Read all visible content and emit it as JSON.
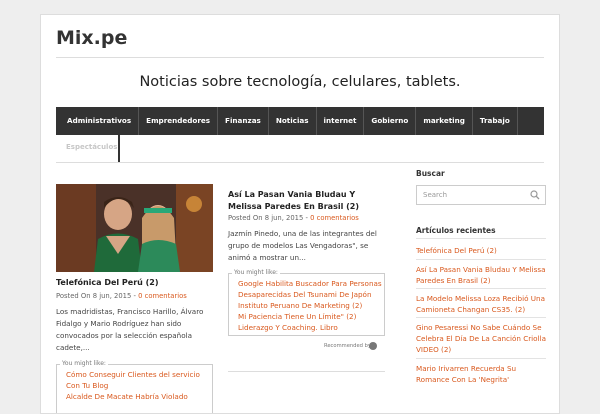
{
  "site": {
    "title": "Mix.pe",
    "tagline": "Noticias sobre tecnología, celulares, tablets."
  },
  "nav": {
    "items": [
      "Administrativos",
      "Emprendedores",
      "Finanzas",
      "Noticias",
      "internet",
      "Gobierno",
      "marketing",
      "Trabajo"
    ],
    "sub": "Espectáculos"
  },
  "posts": [
    {
      "title": "Telefónica Del Perú (2)",
      "posted_on": "Posted On",
      "date": "8 jun, 2015",
      "sep": "-",
      "comments": "0 comentarios",
      "excerpt": "Los madridistas, Francisco Harillo, Álvaro Fidalgo y Mario Rodríguez han sido convocados por la selección española cadete,...",
      "you_might_like": "You might like:",
      "related": [
        "Cómo Conseguir Clientes del servicio Con Tu Blog",
        "Alcalde De Macate Habría Violado"
      ]
    },
    {
      "title": "Así La Pasan Vania Bludau Y Melissa Paredes En Brasil (2)",
      "posted_on": "Posted On",
      "date": "8 jun, 2015",
      "sep": "-",
      "comments": "0 comentarios",
      "excerpt": "Jazmín Pinedo, una de las integrantes del grupo de modelos Las Vengadoras\", se animó a mostrar un...",
      "you_might_like": "You might like:",
      "related": [
        "Google Habilita Buscador Para Personas Desaparecidas Del Tsunami De Japón",
        "Instituto Peruano De Marketing (2)",
        "Mi Paciencia Tiene Un Límite\" (2)",
        "Liderazgo Y Coaching. Libro"
      ],
      "recommended_by": "Recommended by"
    }
  ],
  "sidebar": {
    "search_heading": "Buscar",
    "search_placeholder": "Search",
    "recent_heading": "Artículos recientes",
    "recent": [
      "Telefónica Del Perú (2)",
      "Así La Pasan Vania Bludau Y Melissa Paredes En Brasil (2)",
      "La Modelo Melissa Loza Recibió Una Camioneta Changan CS35. (2)",
      "Gino Pesaressi No Sabe Cuándo Se Celebra El Día De La Canción Criolla VIDEO (2)",
      "Mario Irivarren Recuerda Su Romance Con La 'Negrita'"
    ]
  },
  "colors": {
    "accent": "#d9591e",
    "nav_bg": "#333333",
    "page_bg": "#eeeeee"
  }
}
